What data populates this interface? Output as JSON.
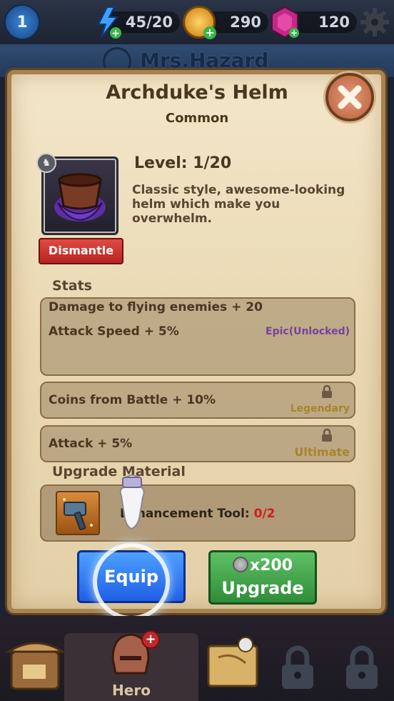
{
  "top_bar": {
    "player_level": "1",
    "energy": "45/20",
    "coins": "290",
    "gems": "120",
    "icons": [
      "star-level-icon",
      "energy-bolt-icon",
      "coin-icon",
      "gem-icon",
      "gear-icon"
    ]
  },
  "hero_name": "Mrs.Hazard",
  "item": {
    "name": "Archduke's Helm",
    "rarity": "Common",
    "level": "Level: 1/20",
    "description": "Classic style, awesome-looking helm which make you overwhelm.",
    "dismantle_label": "Dismantle"
  },
  "stats": {
    "label": "Stats",
    "base": [
      "Damage to flying enemies + 20",
      "Attack Speed + 5%"
    ],
    "epic_tag": "Epic(Unlocked)",
    "legendary_stat": "Coins from Battle + 10%",
    "legendary_tag": "Legendary",
    "ultimate_stat": "Attack + 5%",
    "ultimate_tag": "Ultimate"
  },
  "upgrade_material": {
    "label": "Upgrade Material",
    "name_prefix": "Enhancement Tool: ",
    "count": "0/2"
  },
  "buttons": {
    "equip": "Equip",
    "upgrade_cost": "x200",
    "upgrade": "Upgrade"
  },
  "bottom_nav": {
    "hero_label": "Hero",
    "hero_badge": "+"
  },
  "colors": {
    "panel_bg": "#efe0c0",
    "equip_blue": "#2f73f0",
    "upgrade_green": "#46a64e",
    "dismantle_red": "#cc332d",
    "epic_purple": "#7b3fa0",
    "tier_gold": "#a9842a",
    "material_count_red": "#d01d1d"
  }
}
